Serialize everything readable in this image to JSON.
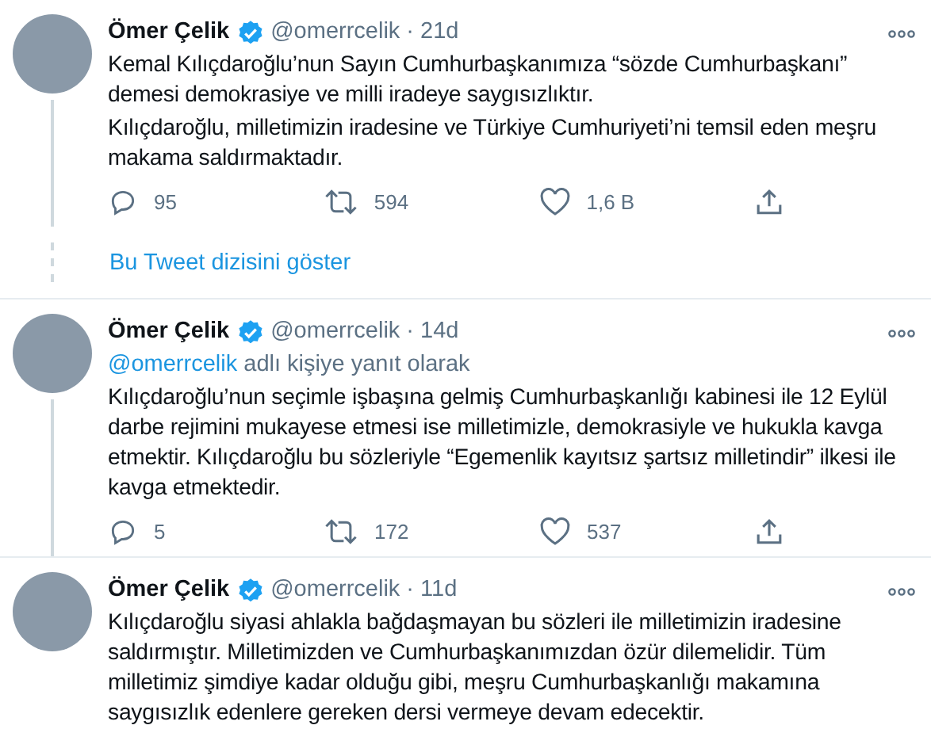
{
  "tweets": [
    {
      "name": "Ömer Çelik",
      "verified": true,
      "handle": "@omerrcelik",
      "separator": "·",
      "time": "21d",
      "thread_below": true,
      "paragraphs": [
        "Kemal Kılıçdaroğlu’nun Sayın Cumhurbaşkanımıza “sözde Cumhurbaşkanı” demesi demokrasiye ve milli iradeye saygısızlıktır.",
        "Kılıçdaroğlu, milletimizin iradesine ve Türkiye Cumhuriyeti’ni temsil eden meşru makama saldırmaktadır."
      ],
      "replies": "95",
      "retweets": "594",
      "likes": "1,6 B"
    },
    {
      "name": "Ömer Çelik",
      "verified": true,
      "handle": "@omerrcelik",
      "separator": "·",
      "time": "14d",
      "thread_below": true,
      "reply_to": {
        "handle": "@omerrcelik",
        "text": "adlı kişiye yanıt olarak"
      },
      "paragraphs": [
        "Kılıçdaroğlu’nun seçimle işbaşına gelmiş Cumhurbaşkanlığı kabinesi ile 12 Eylül darbe rejimini mukayese etmesi ise milletimizle, demokrasiyle ve hukukla kavga etmektir. Kılıçdaroğlu bu sözleriyle “Egemenlik kayıtsız şartsız milletindir” ilkesi ile kavga etmektedir."
      ],
      "replies": "5",
      "retweets": "172",
      "likes": "537"
    },
    {
      "name": "Ömer Çelik",
      "verified": true,
      "handle": "@omerrcelik",
      "separator": "·",
      "time": "11d",
      "paragraphs": [
        "Kılıçdaroğlu siyasi ahlakla bağdaşmayan bu sözleri ile milletimizin iradesine saldırmıştır. Milletimizden ve Cumhurbaşkanımızdan özür dilemelidir. Tüm milletimiz şimdiye kadar olduğu gibi, meşru Cumhurbaşkanlığı makamına saygısızlık edenlere gereken dersi vermeye devam edecektir."
      ]
    }
  ],
  "show_thread": {
    "label": "Bu Tweet dizisini göster"
  }
}
